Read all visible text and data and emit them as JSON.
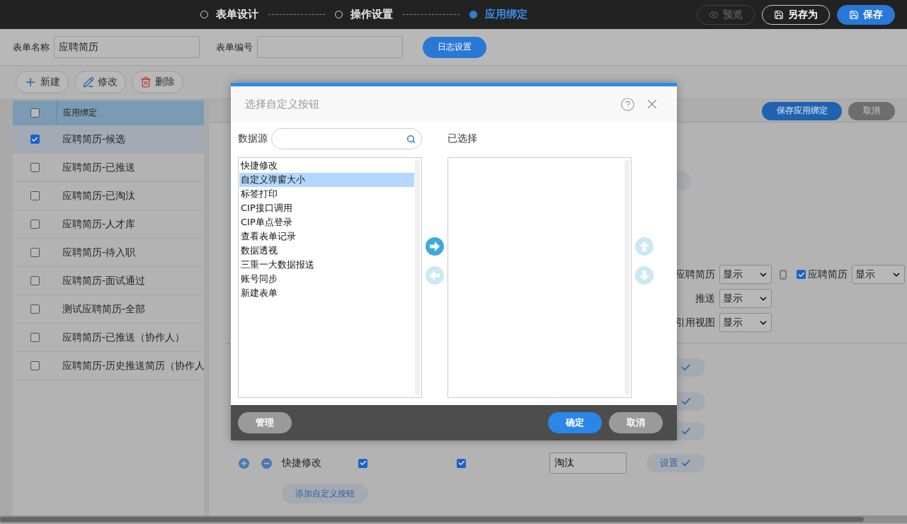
{
  "steps": [
    {
      "label": "表单设计",
      "selected": false
    },
    {
      "label": "操作设置",
      "selected": false
    },
    {
      "label": "应用绑定",
      "selected": true
    }
  ],
  "header_buttons": [
    {
      "label": "预览",
      "kind": "preview",
      "disabled": true
    },
    {
      "label": "另存为",
      "kind": "outline",
      "disabled": false
    },
    {
      "label": "保存",
      "kind": "primary",
      "disabled": false
    }
  ],
  "form": {
    "name_label": "表单名称",
    "name_value": "应聘简历",
    "code_label": "表单编号",
    "log_button": "日志设置"
  },
  "toolbar": [
    {
      "label": "新建",
      "kind": "add"
    },
    {
      "label": "修改",
      "kind": "edit"
    },
    {
      "label": "删除",
      "kind": "delete"
    }
  ],
  "binding_list": {
    "header": "应用绑定",
    "header_checked": false,
    "rows": [
      {
        "label": "应聘简历-候选",
        "checked": true,
        "selected": true
      },
      {
        "label": "应聘简历-已推送",
        "checked": false,
        "selected": false
      },
      {
        "label": "应聘简历-已淘汰",
        "checked": false,
        "selected": false
      },
      {
        "label": "应聘简历-人才库",
        "checked": false,
        "selected": false
      },
      {
        "label": "应聘简历-待入职",
        "checked": false,
        "selected": false
      },
      {
        "label": "应聘简历-面试通过",
        "checked": false,
        "selected": false
      },
      {
        "label": "测试应聘简历-全部",
        "checked": false,
        "selected": false
      },
      {
        "label": "应聘简历-已推送（协作人）",
        "checked": false,
        "selected": false
      },
      {
        "label": "应聘简历-历史推送简历（协作人",
        "checked": false,
        "selected": false
      }
    ]
  },
  "panel": {
    "save_button": "保存应用绑定",
    "cancel_button": "取消",
    "display_rows": [
      {
        "label": "应聘简历",
        "value": "显示",
        "mobile": {
          "checked": true,
          "label": "应聘简历",
          "value": "显示"
        }
      },
      {
        "label": "推送",
        "value": "显示"
      },
      {
        "label": "引用视图",
        "value": "显示"
      }
    ],
    "setting_rows": [
      {
        "confirmed": true
      },
      {
        "confirmed": true
      },
      {
        "confirmed": true
      }
    ],
    "button_row": {
      "name": "快捷修改",
      "first_checked": true,
      "second_checked": true,
      "value": "淘汰",
      "settings": "设置"
    },
    "add_button": "添加自定义按钮"
  },
  "dialog": {
    "title": "选择自定义按钮",
    "source_label": "数据源",
    "selected_label": "已选择",
    "source_items": [
      {
        "label": "快捷修改",
        "selected": false
      },
      {
        "label": "自定义弹窗大小",
        "selected": true
      },
      {
        "label": "标签打印",
        "selected": false
      },
      {
        "label": "CIP接口调用",
        "selected": false
      },
      {
        "label": "CIP单点登录",
        "selected": false
      },
      {
        "label": "查看表单记录",
        "selected": false
      },
      {
        "label": "数据透视",
        "selected": false
      },
      {
        "label": "三重一大数据报送",
        "selected": false
      },
      {
        "label": "账号同步",
        "selected": false
      },
      {
        "label": "新建表单",
        "selected": false
      }
    ],
    "transfer_buttons": [
      {
        "kind": "right",
        "disabled": false
      },
      {
        "kind": "left",
        "disabled": true
      }
    ],
    "order_buttons": [
      {
        "kind": "up",
        "disabled": true
      },
      {
        "kind": "down",
        "disabled": true
      }
    ],
    "footer_buttons": [
      {
        "label": "管理",
        "kind": "secondary"
      },
      {
        "label": "确定",
        "kind": "primary"
      },
      {
        "label": "取消",
        "kind": "secondary"
      }
    ]
  }
}
